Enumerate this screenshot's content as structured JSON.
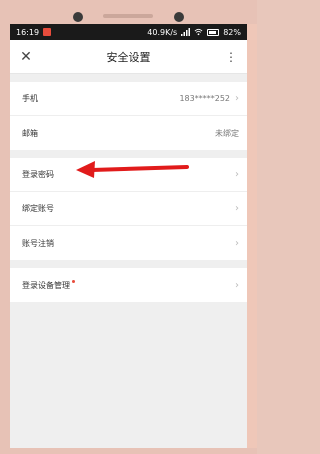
{
  "statusbar": {
    "time": "16:19",
    "network": "40.9K/s",
    "battery": "82%"
  },
  "header": {
    "title": "安全设置",
    "close_icon": "close-icon",
    "more_icon": "more-vertical-icon"
  },
  "group1": [
    {
      "label": "手机",
      "value": "183*****252"
    },
    {
      "label": "邮箱",
      "value": "未绑定"
    }
  ],
  "group2": [
    {
      "label": "登录密码"
    },
    {
      "label": "绑定账号"
    },
    {
      "label": "账号注销"
    }
  ],
  "group3": [
    {
      "label": "登录设备管理"
    }
  ],
  "colors": {
    "accent_arrow": "#e11b1b",
    "background": "#efefef"
  }
}
